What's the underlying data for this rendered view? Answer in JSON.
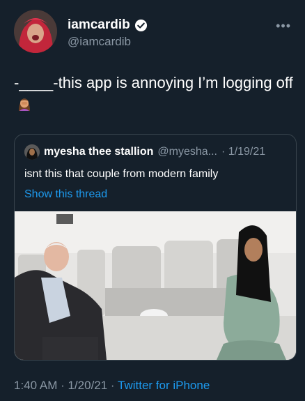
{
  "author": {
    "display_name": "iamcardib",
    "handle": "@iamcardib"
  },
  "tweet": {
    "text": "-____-this app is annoying I’m logging off",
    "emoji": "woman-facepalming-emoji"
  },
  "quoted": {
    "display_name": "myesha thee stallion",
    "handle": "@myesha...",
    "date": "· 1/19/21",
    "text": "isnt this that couple from modern family",
    "link": "Show this thread"
  },
  "footer": {
    "time": "1:40 AM · 1/20/21 · ",
    "app": "Twitter for iPhone"
  },
  "colors": {
    "background": "#15202b",
    "secondary_text": "#8b98a5",
    "link": "#1d9bf0",
    "border": "#38444d"
  },
  "icons": [
    "verified-badge-icon",
    "more-options-icon",
    "woman-facepalming-emoji"
  ]
}
